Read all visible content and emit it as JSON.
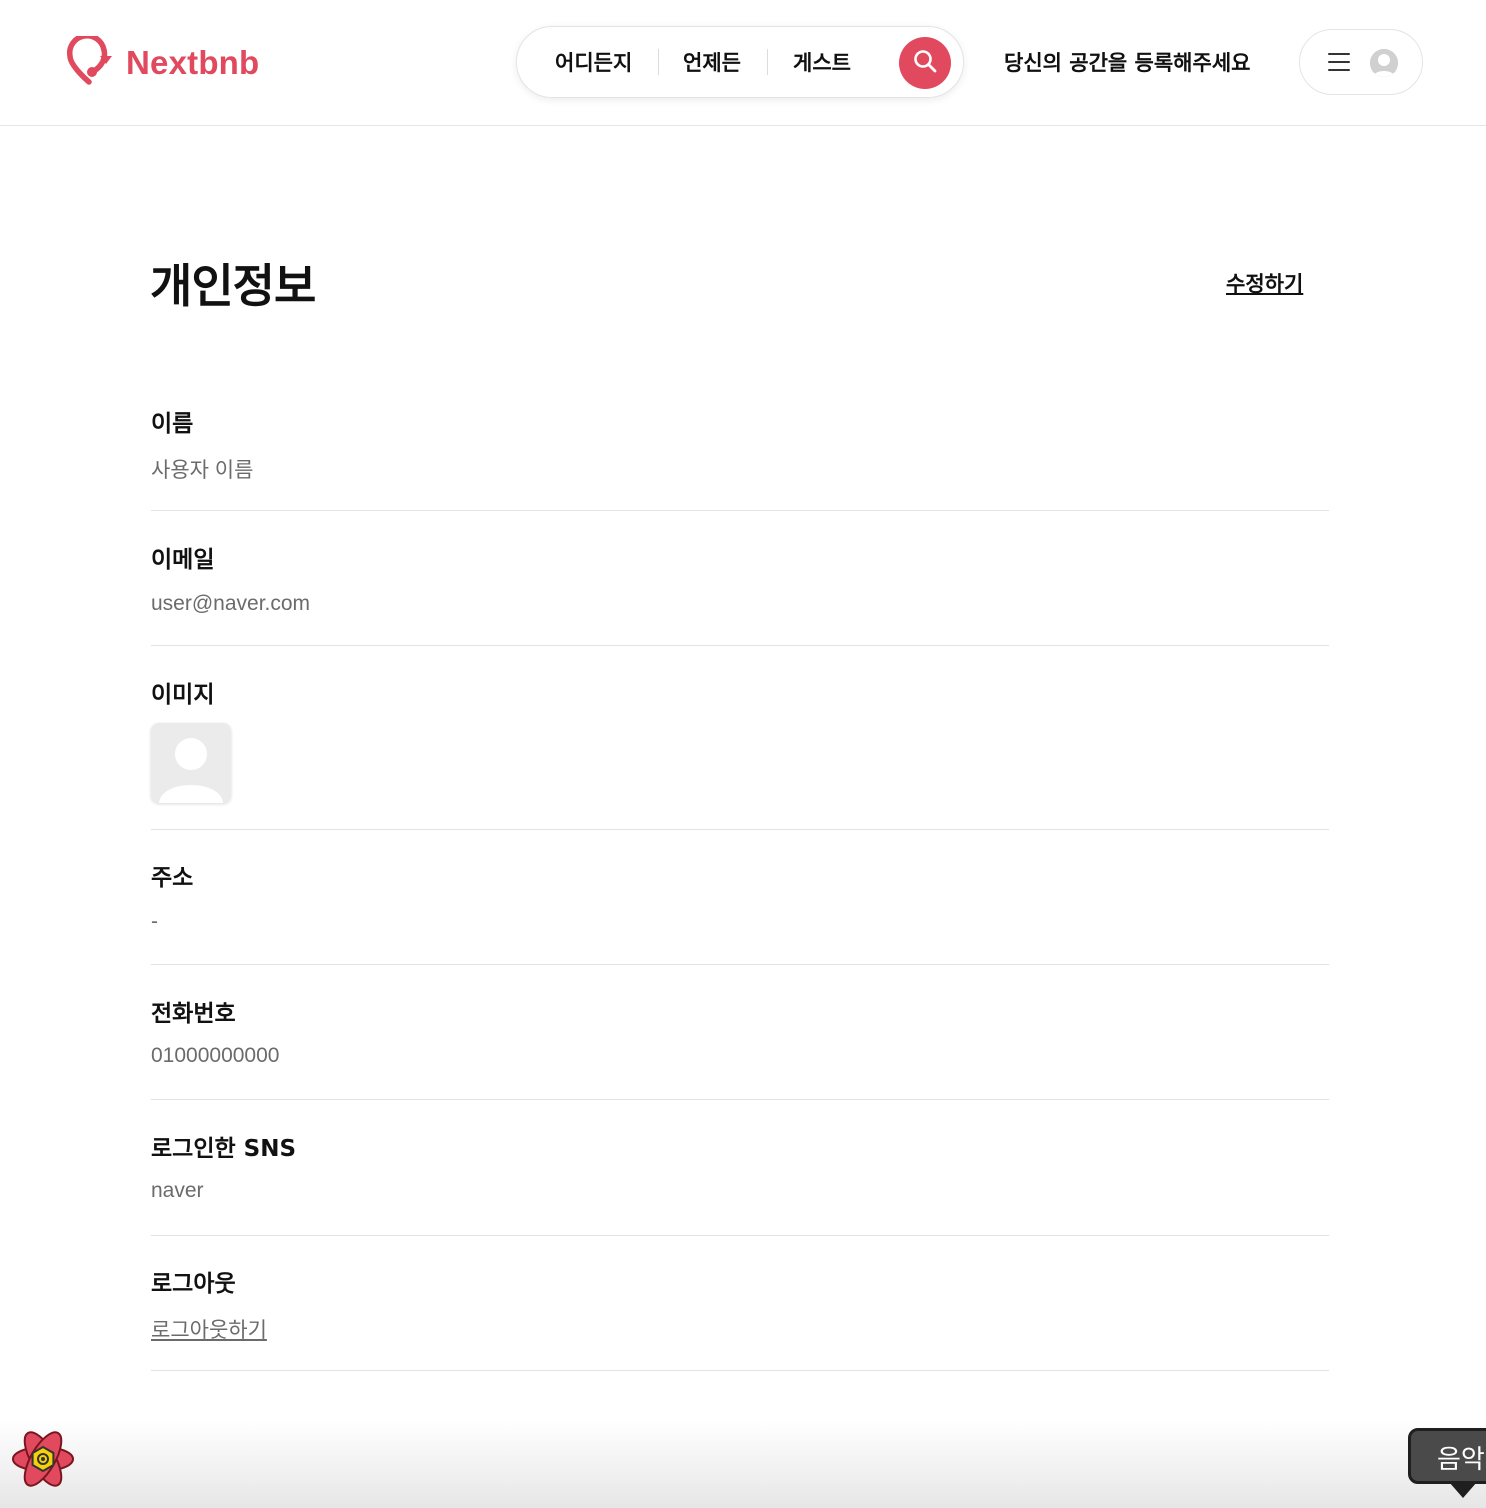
{
  "brand": {
    "name": "Nextbnb",
    "accent": "#e0495e"
  },
  "search": {
    "where": "어디든지",
    "when": "언제든",
    "guests": "게스트"
  },
  "header": {
    "host_link": "당신의 공간을 등록해주세요"
  },
  "page": {
    "title": "개인정보",
    "edit_label": "수정하기"
  },
  "profile": {
    "name_label": "이름",
    "name_value": "사용자 이름",
    "email_label": "이메일",
    "email_value": "user@naver.com",
    "image_label": "이미지",
    "address_label": "주소",
    "address_value": "-",
    "phone_label": "전화번호",
    "phone_value": "01000000000",
    "sns_label": "로그인한 SNS",
    "sns_value": "naver",
    "logout_label": "로그아웃",
    "logout_link": "로그아웃하기"
  },
  "music_tooltip": "음악"
}
